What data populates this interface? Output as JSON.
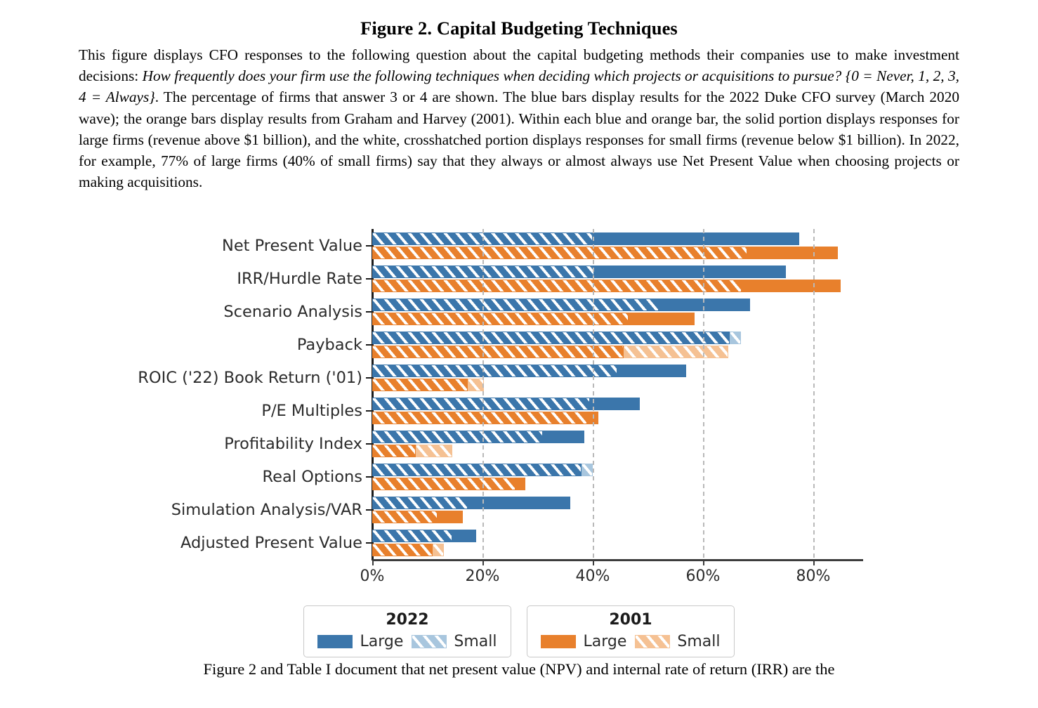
{
  "figure": {
    "title": "Figure 2. Capital Budgeting Techniques",
    "caption_p1": "This figure displays CFO responses to the following question about the capital budgeting methods their companies use to make investment decisions: ",
    "caption_q": "How frequently does your firm use the following techniques when deciding which projects or acquisitions to pursue? {0 = Never, 1, 2, 3, 4 = Always}",
    "caption_p2": ". The percentage of firms that answer 3 or 4 are shown. The blue bars display results for the 2022 Duke CFO survey (March 2020 wave); the orange bars display results from Graham and Harvey (2001). Within each blue and orange bar, the solid portion displays responses for large firms (revenue above $1 billion), and the white, crosshatched portion displays responses for small firms (revenue below $1 billion). In 2022, for example, 77% of large firms (40% of small firms) say that they always or almost always use Net Present Value when choosing projects or making acquisitions."
  },
  "body_text": "Figure 2 and Table I document that net present value (NPV) and internal rate of return (IRR) are the",
  "legend": {
    "groups": [
      {
        "title": "2022",
        "large_label": "Large",
        "small_label": "Small",
        "large_color": "#3b76ab",
        "small_color": "#a8c6de"
      },
      {
        "title": "2001",
        "large_label": "Large",
        "small_label": "Small",
        "large_color": "#e8802c",
        "small_color": "#f5c193"
      }
    ]
  },
  "chart_data": {
    "type": "bar",
    "orientation": "horizontal",
    "title": "Figure 2. Capital Budgeting Techniques",
    "xlabel": "",
    "ylabel": "",
    "xlim": [
      0,
      89
    ],
    "xticks": [
      0,
      20,
      40,
      60,
      80
    ],
    "xticklabels": [
      "0%",
      "20%",
      "40%",
      "60%",
      "80%"
    ],
    "grid": "x-only-dashed",
    "legend_position": "below-center",
    "categories": [
      "Net Present Value",
      "IRR/Hurdle Rate",
      "Scenario Analysis",
      "Payback",
      "ROIC ('22) Book Return ('01)",
      "P/E Multiples",
      "Profitability Index",
      "Real Options",
      "Simulation Analysis/VAR",
      "Adjusted Present Value"
    ],
    "series": [
      {
        "name": "2022 Large",
        "color": "#3b76ab",
        "values": [
          77.5,
          75.0,
          68.5,
          64.8,
          57.0,
          48.5,
          38.5,
          38.0,
          35.9,
          18.9
        ]
      },
      {
        "name": "2022 Small",
        "color": "#3b76ab",
        "hatched": true,
        "values": [
          40.0,
          40.2,
          52.0,
          66.9,
          44.5,
          39.5,
          31.0,
          40.0,
          17.3,
          14.5
        ]
      },
      {
        "name": "2001 Large",
        "color": "#e8802c",
        "values": [
          84.5,
          85.0,
          58.5,
          45.6,
          17.3,
          41.0,
          7.9,
          27.8,
          16.4,
          11.0
        ]
      },
      {
        "name": "2001 Small",
        "color": "#e8802c",
        "hatched": true,
        "values": [
          68.0,
          67.0,
          46.5,
          64.6,
          20.2,
          39.0,
          14.5,
          26.0,
          11.8,
          13.0
        ]
      }
    ]
  }
}
